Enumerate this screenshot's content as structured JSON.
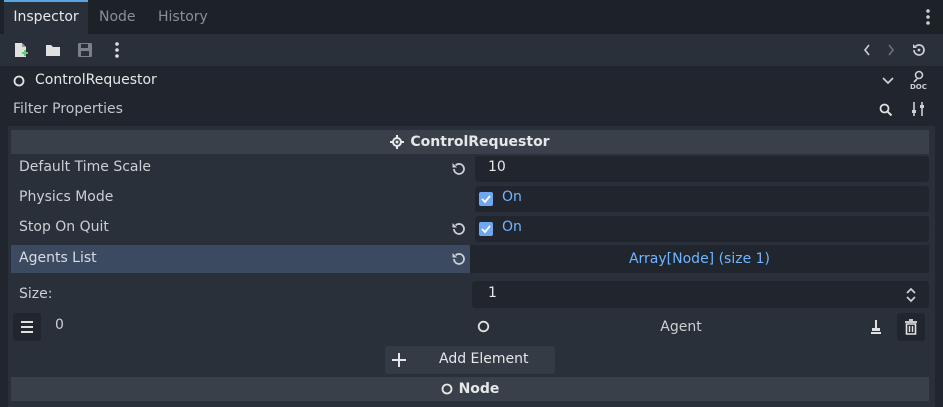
{
  "tabs": [
    {
      "label": "Inspector"
    },
    {
      "label": "Node"
    },
    {
      "label": "History"
    }
  ],
  "object": {
    "name": "ControlRequestor"
  },
  "filter": {
    "placeholder": "Filter Properties"
  },
  "section": {
    "title": "ControlRequestor"
  },
  "props": {
    "time_scale": {
      "label": "Default Time Scale",
      "value": "10"
    },
    "physics_mode": {
      "label": "Physics Mode",
      "value": "On"
    },
    "stop_on_quit": {
      "label": "Stop On Quit",
      "value": "On"
    },
    "agents_list": {
      "label": "Agents List",
      "value": "Array[Node] (size 1)"
    }
  },
  "array": {
    "size_label": "Size:",
    "size_value": "1",
    "element_index": "0",
    "element_value": "Agent",
    "add_label": "Add Element"
  },
  "node_section": {
    "title": "Node"
  },
  "colors": {
    "accent": "#58a6dd",
    "check": "#6fa8f2",
    "value_blue": "#70b5ff",
    "highlight_row": "#3b4a60"
  }
}
